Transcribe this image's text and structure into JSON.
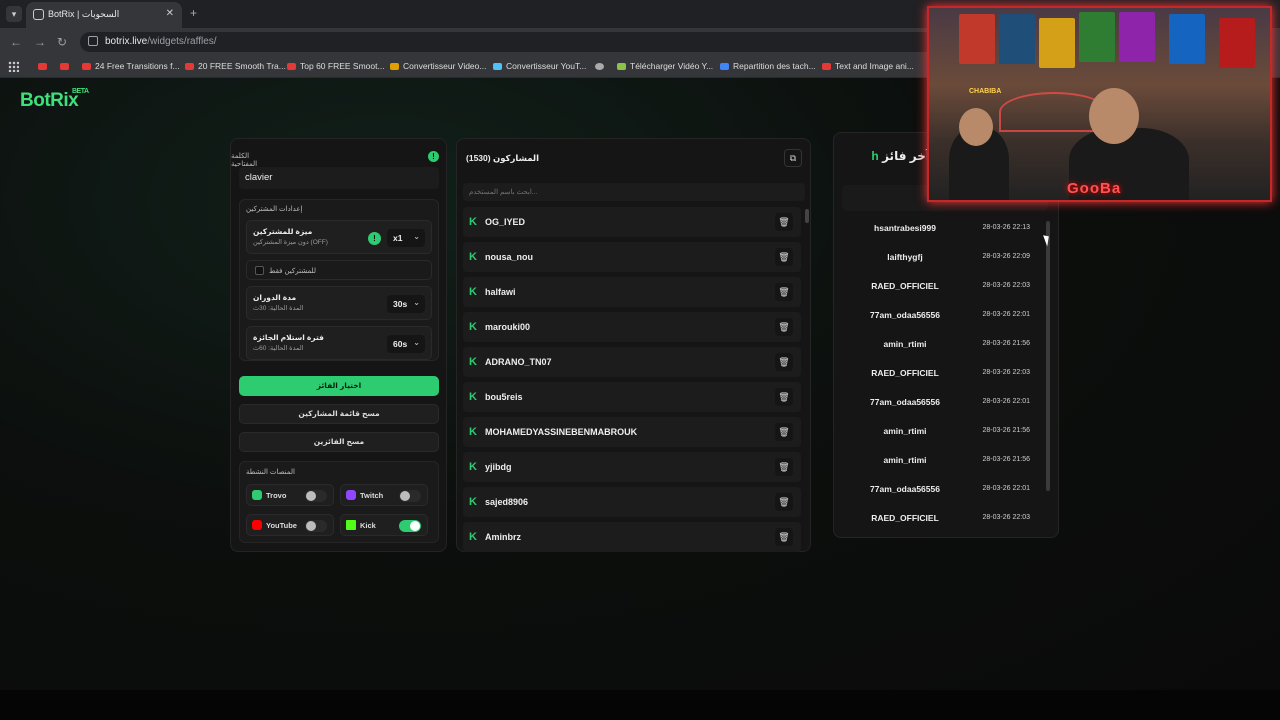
{
  "browser": {
    "tab_title": "BotRix | السحوبات",
    "tab_close": "✕",
    "new_tab": "+",
    "url_host": "botrix.live",
    "url_path": "/widgets/raffles/",
    "bookmarks": [
      {
        "label": ""
      },
      {
        "label": ""
      },
      {
        "label": "24 Free Transitions f..."
      },
      {
        "label": "20 FREE Smooth Tra..."
      },
      {
        "label": "Top 60 FREE Smoot..."
      },
      {
        "label": "Convertisseur Video..."
      },
      {
        "label": "Convertisseur YouT..."
      },
      {
        "label": ""
      },
      {
        "label": "Télécharger Vidéo Y..."
      },
      {
        "label": "Repartition des tach..."
      },
      {
        "label": "Text and Image ani..."
      }
    ]
  },
  "app": {
    "logo": "BotRix",
    "logo_badge": "BETA"
  },
  "settings": {
    "keyword_label": "الكلمة المفتاحية",
    "keyword_value": "clavier",
    "participants_settings_label": "إعدادات المشتركين",
    "subscriber_bonus_title": "ميزة للمشتركين",
    "subscriber_bonus_sub": "دون ميزة المشتركين (OFF)",
    "subscriber_bonus_value": "x1",
    "subscribers_only_label": "للمشتركين فقط",
    "duration_title": "مدة الدوران",
    "duration_sub": "المدة الحالية: 30ث",
    "duration_value": "30s",
    "claim_title": "فترة استلام الجائزة",
    "claim_sub": "المدة الحالية: 60ث",
    "claim_value": "60s",
    "pick_winner_button": "اختيار الفائز",
    "clear_participants_button": "مسح قائمة المشاركين",
    "clear_winners_button": "مسح الفائزين",
    "platforms_label": "المنصات النشطة",
    "platforms": [
      {
        "name": "Trovo",
        "on": false,
        "color": "#2ecc71"
      },
      {
        "name": "Twitch",
        "on": false,
        "color": "#9146ff"
      },
      {
        "name": "YouTube",
        "on": false,
        "color": "#ff0000"
      },
      {
        "name": "Kick",
        "on": true,
        "color": "#53fc18"
      }
    ]
  },
  "participants": {
    "title": "المشاركون (1530)",
    "search_placeholder": "ابحث باسم المستخدم...",
    "items": [
      "OG_IYED",
      "nousa_nou",
      "halfawi",
      "marouki00",
      "ADRANO_TN07",
      "bou5reis",
      "MOHAMEDYASSINEBENMABROUK",
      "yjibdg",
      "sajed8906",
      "Aminbrz"
    ]
  },
  "winners": {
    "title_prefix": "h",
    "title": "آخر فائز",
    "items": [
      {
        "name": "hsantrabesi999",
        "date": "28-03-26 22:13"
      },
      {
        "name": "laifthygfj",
        "date": "28-03-26 22:09"
      },
      {
        "name": "RAED_OFFICIEL",
        "date": "28-03-26 22:03"
      },
      {
        "name": "77am_odaa56556",
        "date": "28-03-26 22:01"
      },
      {
        "name": "amin_rtimi",
        "date": "28-03-26 21:56"
      },
      {
        "name": "RAED_OFFICIEL",
        "date": "28-03-26 22:03"
      },
      {
        "name": "77am_odaa56556",
        "date": "28-03-26 22:01"
      },
      {
        "name": "amin_rtimi",
        "date": "28-03-26 21:56"
      },
      {
        "name": "amin_rtimi",
        "date": "28-03-26 21:56"
      },
      {
        "name": "77am_odaa56556",
        "date": "28-03-26 22:01"
      },
      {
        "name": "RAED_OFFICIEL",
        "date": "28-03-26 22:03"
      }
    ]
  },
  "webcam": {
    "overlay_text": "GooBa",
    "sign_text": "CHABIBA"
  }
}
